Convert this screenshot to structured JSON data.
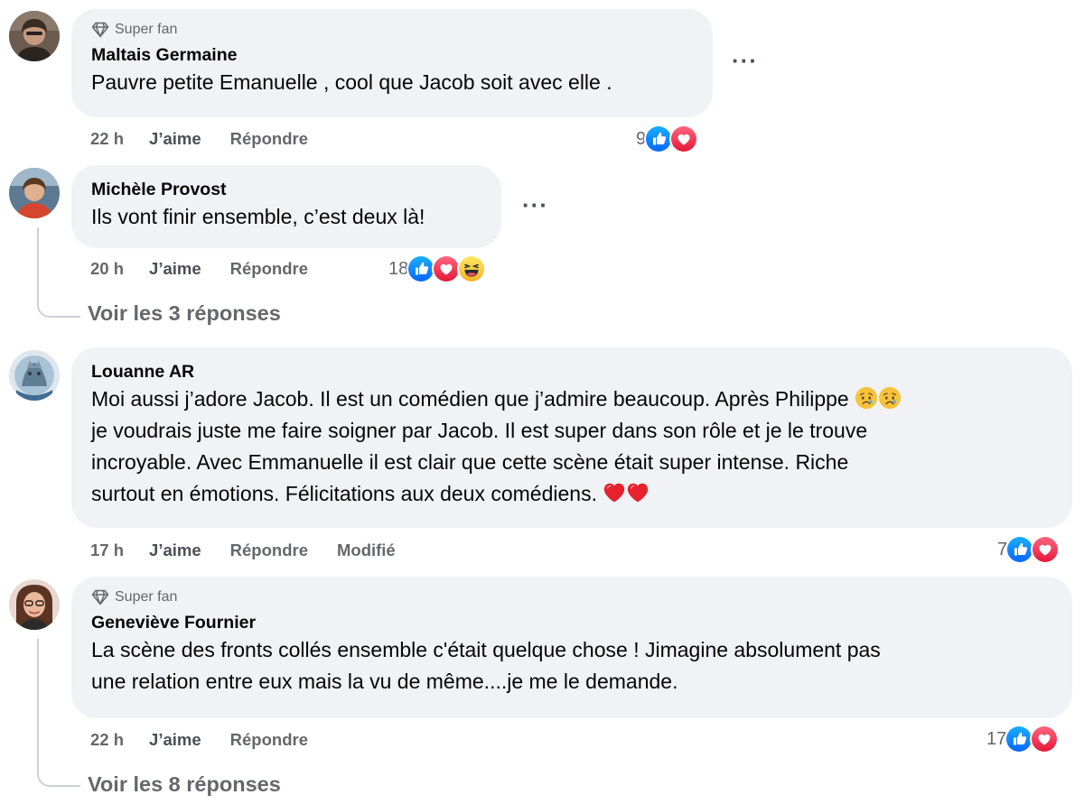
{
  "comments": [
    {
      "badge": "Super fan",
      "author": "Maltais Germaine",
      "lines": [
        "Pauvre petite Emanuelle , cool que Jacob soit avec elle ."
      ],
      "time": "22 h",
      "like": "J’aime",
      "reply": "Répondre",
      "edited": "",
      "reaction_count": "9",
      "reactions": [
        "like",
        "love"
      ]
    },
    {
      "badge": "",
      "author": "Michèle Provost",
      "lines": [
        "Ils vont finir ensemble, c’est deux là!"
      ],
      "time": "20 h",
      "like": "J’aime",
      "reply": "Répondre",
      "edited": "",
      "reaction_count": "18",
      "reactions": [
        "like",
        "love",
        "haha"
      ],
      "view_replies": "Voir les 3 réponses"
    },
    {
      "badge": "",
      "author": "Louanne AR",
      "lines": [
        "Moi aussi j’adore Jacob. Il est un comédien que j’admire beaucoup. Après Philippe",
        "je voudrais juste me faire soigner par Jacob. Il est super dans son rôle et je le trouve",
        "incroyable. Avec Emmanuelle il est clair que cette scène était super intense. Riche",
        "surtout en émotions. Félicitations aux deux comédiens."
      ],
      "time": "17 h",
      "like": "J’aime",
      "reply": "Répondre",
      "edited": "Modifié",
      "reaction_count": "7",
      "reactions": [
        "like",
        "love"
      ]
    },
    {
      "badge": "Super fan",
      "author": "Geneviève Fournier",
      "lines": [
        "La scène des fronts collés ensemble c'était quelque chose ! Jimagine absolument pas",
        "une relation entre eux mais la vu de même....je me le demande."
      ],
      "time": "22 h",
      "like": "J’aime",
      "reply": "Répondre",
      "edited": "",
      "reaction_count": "17",
      "reactions": [
        "like",
        "love"
      ],
      "view_replies": "Voir les 8 réponses"
    }
  ],
  "colors": {
    "like_blue": "#1877f2",
    "love_red": "#f33e58",
    "bubble_bg": "#f0f2f5",
    "meta_gray": "#65676b"
  },
  "icons": {
    "badge": "diamond-icon",
    "more": "more-options-icon",
    "inline_emojis_comment3": [
      "sad-face-emoji",
      "sad-face-emoji",
      "red-heart-emoji",
      "red-heart-emoji"
    ]
  }
}
